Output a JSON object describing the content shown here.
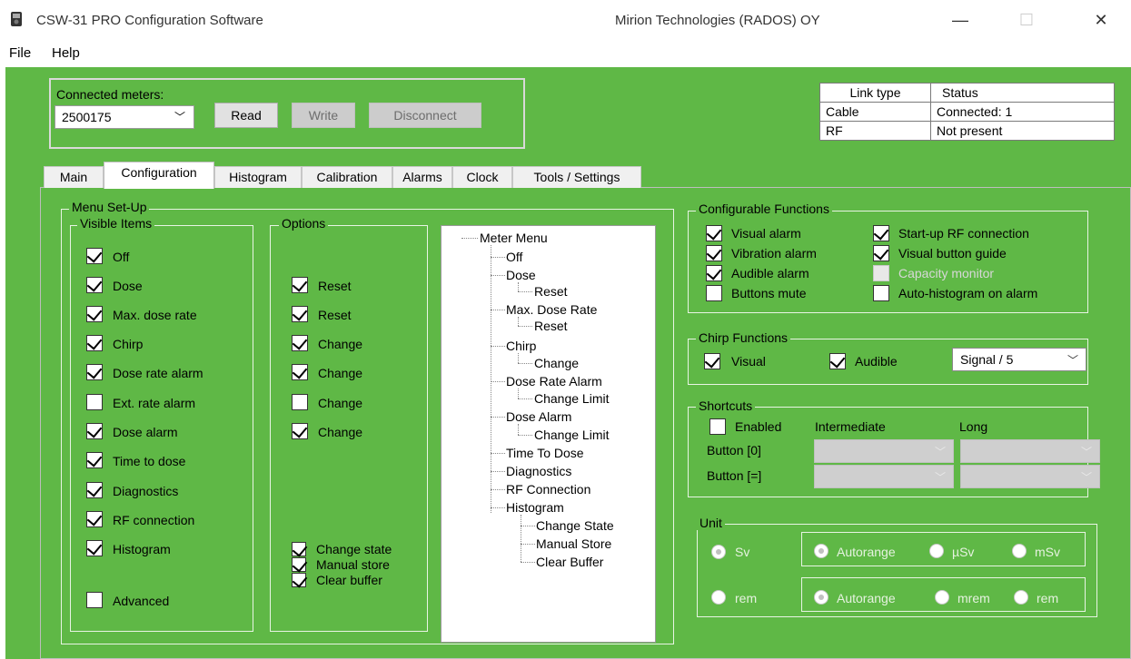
{
  "window": {
    "title": "CSW-31 PRO Configuration Software",
    "company": "Mirion Technologies (RADOS) OY",
    "min_glyph": "—",
    "max_glyph": "☐",
    "close_glyph": "✕"
  },
  "menubar": {
    "file": "File",
    "help": "Help"
  },
  "connection": {
    "label": "Connected meters:",
    "selected_meter": "2500175",
    "read": "Read",
    "write": "Write",
    "disconnect": "Disconnect"
  },
  "link_table": {
    "headers": [
      "Link type",
      "Status"
    ],
    "rows": [
      [
        "Cable",
        "Connected: 1"
      ],
      [
        "RF",
        "Not present"
      ]
    ]
  },
  "tabs": [
    "Main",
    "Configuration",
    "Histogram",
    "Calibration",
    "Alarms",
    "Clock",
    "Tools / Settings"
  ],
  "active_tab": "Configuration",
  "menu_setup": {
    "title": "Menu Set-Up",
    "visible_title": "Visible Items",
    "options_title": "Options",
    "visible_items": [
      {
        "label": "Off",
        "checked": true
      },
      {
        "label": "Dose",
        "checked": true
      },
      {
        "label": "Max. dose rate",
        "checked": true
      },
      {
        "label": "Chirp",
        "checked": true
      },
      {
        "label": "Dose rate alarm",
        "checked": true
      },
      {
        "label": "Ext. rate alarm",
        "checked": false
      },
      {
        "label": "Dose alarm",
        "checked": true
      },
      {
        "label": "Time to dose",
        "checked": true
      },
      {
        "label": "Diagnostics",
        "checked": true
      },
      {
        "label": "RF connection",
        "checked": true
      },
      {
        "label": "Histogram",
        "checked": true
      },
      {
        "label": "Advanced",
        "checked": false
      }
    ],
    "options": [
      {
        "label": "Reset",
        "checked": true
      },
      {
        "label": "Reset",
        "checked": true
      },
      {
        "label": "Change",
        "checked": true
      },
      {
        "label": "Change",
        "checked": true
      },
      {
        "label": "Change",
        "checked": false
      },
      {
        "label": "Change",
        "checked": true
      }
    ],
    "histogram_options": [
      {
        "label": "Change state",
        "checked": true
      },
      {
        "label": "Manual store",
        "checked": true
      },
      {
        "label": "Clear buffer",
        "checked": true
      }
    ]
  },
  "meter_menu": {
    "root": "Meter Menu",
    "items": [
      "Off",
      "Dose",
      "Reset",
      "Max. Dose Rate",
      "Reset",
      "Chirp",
      "Change",
      "Dose Rate Alarm",
      "Change Limit",
      "Dose Alarm",
      "Change Limit",
      "Time To Dose",
      "Diagnostics",
      "RF Connection",
      "Histogram",
      "Change State",
      "Manual Store",
      "Clear Buffer"
    ]
  },
  "configurable": {
    "title": "Configurable Functions",
    "items": [
      {
        "label": "Visual alarm",
        "checked": true,
        "enabled": true
      },
      {
        "label": "Start-up RF connection",
        "checked": true,
        "enabled": true
      },
      {
        "label": "Vibration alarm",
        "checked": true,
        "enabled": true
      },
      {
        "label": "Visual button guide",
        "checked": true,
        "enabled": true
      },
      {
        "label": "Audible alarm",
        "checked": true,
        "enabled": true
      },
      {
        "label": "Capacity monitor",
        "checked": false,
        "enabled": false
      },
      {
        "label": "Buttons mute",
        "checked": false,
        "enabled": true
      },
      {
        "label": "Auto-histogram on alarm",
        "checked": false,
        "enabled": true
      }
    ]
  },
  "chirp": {
    "title": "Chirp Functions",
    "visual": "Visual",
    "audible": "Audible",
    "signal": "Signal / 5"
  },
  "shortcuts": {
    "title": "Shortcuts",
    "enabled": "Enabled",
    "intermediate": "Intermediate",
    "long": "Long",
    "button0": "Button [0]",
    "button1": "Button [=]"
  },
  "unit": {
    "title": "Unit",
    "sv": "Sv",
    "rem": "rem",
    "autorange1": "Autorange",
    "usv": "µSv",
    "msv": "mSv",
    "autorange2": "Autorange",
    "mrem": "mrem",
    "rem2": "rem"
  }
}
